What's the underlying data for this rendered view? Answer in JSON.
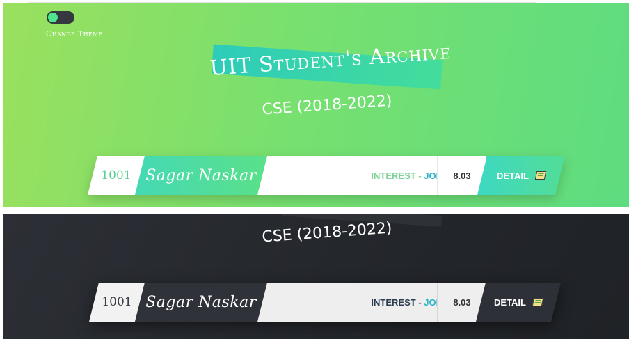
{
  "theme_toggle": {
    "label": "Change Theme"
  },
  "header": {
    "title": "UIT Student's Archive",
    "subtitle": "CSE (2018-2022)"
  },
  "colors": {
    "light_gradient_start": "#9ae05e",
    "light_gradient_end": "#5edc80",
    "accent_teal": "#3ed8c3",
    "dark_background": "#23262b",
    "interest_light": "#7fd39a",
    "interest_dark": "#2c3e50",
    "job_accent": "#29b6c8"
  },
  "light_view": {
    "student": {
      "id": "1001",
      "name": "Sagar Naskar",
      "interest_label": "INTEREST - ",
      "interest_value": "JOB",
      "cgpa": "8.03",
      "detail_label": "DETAIL",
      "detail_icon": "book-icon"
    }
  },
  "dark_view": {
    "subtitle": "CSE (2018-2022)",
    "student": {
      "id": "1001",
      "name": "Sagar Naskar",
      "interest_label": "INTEREST - ",
      "interest_value": "JOB",
      "cgpa": "8.03",
      "detail_label": "DETAIL",
      "detail_icon": "book-icon"
    }
  }
}
